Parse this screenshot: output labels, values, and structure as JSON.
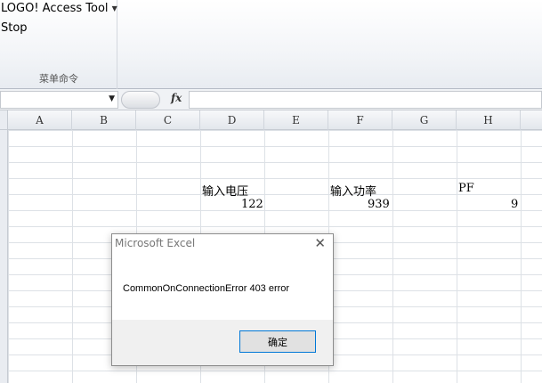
{
  "ribbon": {
    "menu_label": "LOGO! Access Tool",
    "stop_label": "Stop",
    "group_label": "菜单命令"
  },
  "formula_bar": {
    "namebox_value": "",
    "fx_label": "fx",
    "formula_value": ""
  },
  "columns": [
    "A",
    "B",
    "C",
    "D",
    "E",
    "F",
    "G",
    "H"
  ],
  "cells": {
    "d_header": "输入电压",
    "f_header": "输入功率",
    "h_header": "PF",
    "d_value": "122",
    "f_value": "939",
    "h_value": "9"
  },
  "dialog": {
    "title": "Microsoft Excel",
    "close": "✕",
    "message": "CommonOnConnectionError 403 error",
    "ok_label": "确定"
  }
}
